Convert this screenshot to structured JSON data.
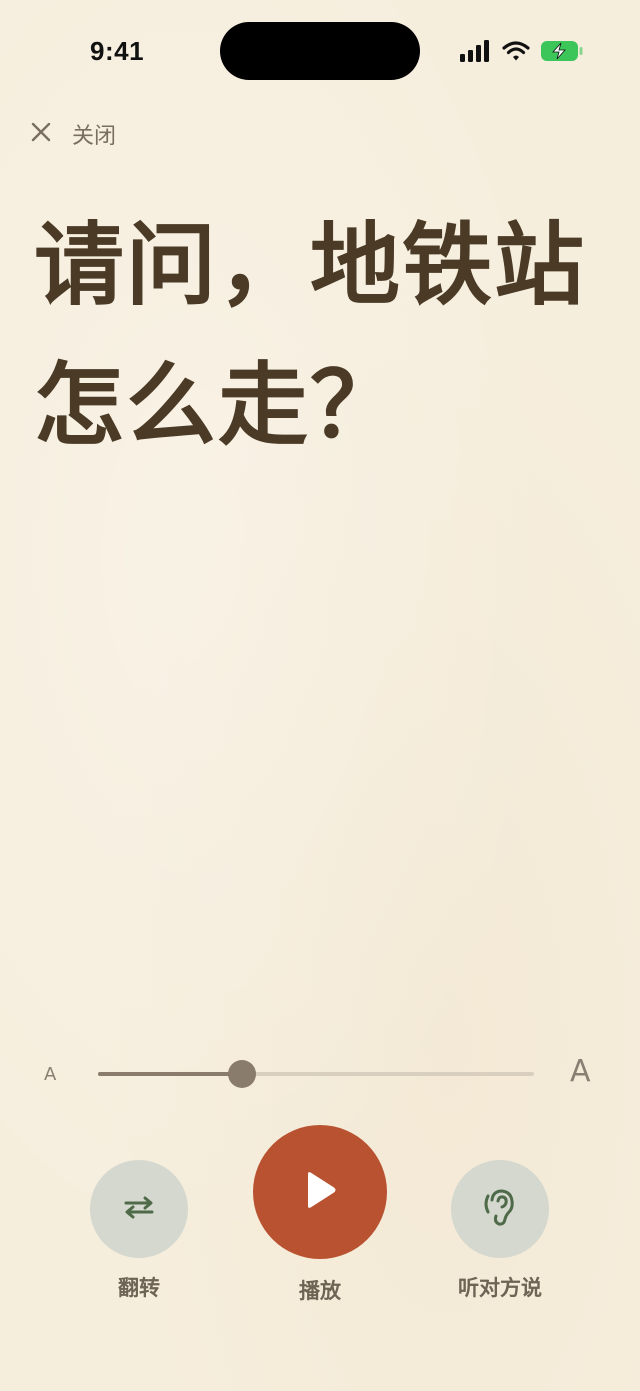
{
  "status_bar": {
    "time": "9:41"
  },
  "header": {
    "close_label": "关闭"
  },
  "phrase": {
    "text": "请问，地铁站怎么走？"
  },
  "font_size_slider": {
    "small_label": "A",
    "large_label": "A",
    "level": 0.33
  },
  "controls": {
    "flip_label": "翻转",
    "play_label": "播放",
    "listen_label": "听对方说"
  },
  "colors": {
    "background": "#F6EEDD",
    "text": "#4a3a26",
    "accent_play": "#B85230",
    "secondary_button": "#D4D8CF",
    "icon_green": "#4f6a48",
    "battery": "#3CC65A"
  },
  "icons": {
    "close": "close-icon",
    "flip": "swap-arrows-icon",
    "play": "play-icon",
    "listen": "ear-icon",
    "signal": "cellular-signal-icon",
    "wifi": "wifi-icon",
    "battery": "battery-charging-icon"
  }
}
